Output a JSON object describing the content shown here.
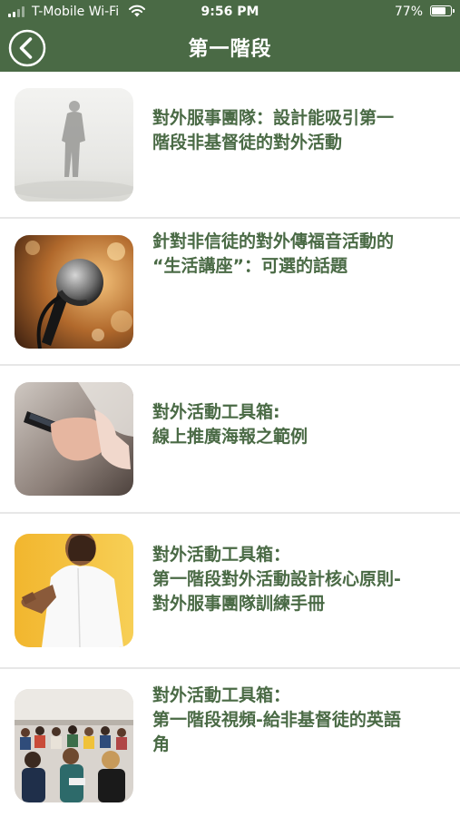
{
  "status_bar": {
    "carrier": "T-Mobile Wi-Fi",
    "time": "9:56 PM",
    "battery_percent": "77%",
    "battery_level": 0.77
  },
  "nav": {
    "title": "第一階段",
    "back_icon": "chevron-left-circle-icon"
  },
  "colors": {
    "header_bg": "#4a6a45",
    "title_text": "#4a6a45",
    "separator": "#e7e7e7"
  },
  "items": [
    {
      "title": "對外服事團隊：設計能吸引第一\n階段非基督徒的對外活動",
      "thumbnail": "person-in-fog"
    },
    {
      "title": "針對非信徒的對外傳福音活動的\n“生活講座”：可選的話題",
      "thumbnail": "microphone"
    },
    {
      "title": "對外活動工具箱:\n線上推廣海報之範例",
      "thumbnail": "hand-holding-phone"
    },
    {
      "title": "對外活動工具箱：\n第一階段對外活動設計核心原則-\n對外服事團隊訓練手冊",
      "thumbnail": "woman-offering-handshake"
    },
    {
      "title": "對外活動工具箱：\n第一階段視頻-給非基督徒的英語\n角",
      "thumbnail": "group-meeting"
    }
  ]
}
